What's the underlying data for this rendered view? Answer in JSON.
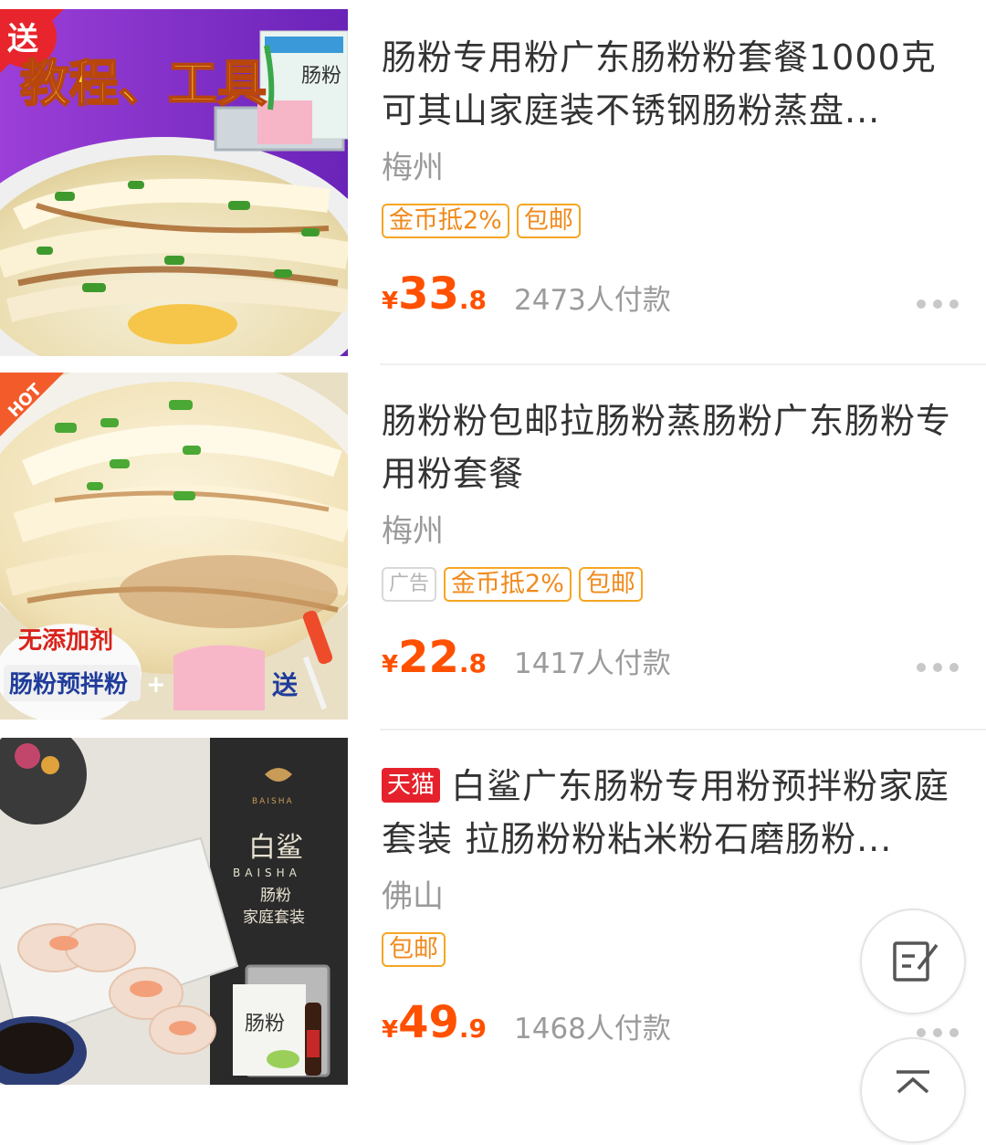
{
  "products": [
    {
      "badge": "送",
      "banner": "教程、工具",
      "pack_text": "肠粉",
      "title": "肠粉专用粉广东肠粉粉套餐1000克可其山家庭装不锈钢肠粉蒸盘...",
      "location": "梅州",
      "tags": [
        "金币抵2%",
        "包邮"
      ],
      "price_symbol": "¥",
      "price_int": "33",
      "price_dec": ".8",
      "paid": "2473人付款"
    },
    {
      "corner": "HOT",
      "promo_line1": "无添加剂",
      "promo_line2": "肠粉预拌粉",
      "plus": "+",
      "gift": "送",
      "title": "肠粉粉包邮拉肠粉蒸肠粉广东肠粉专用粉套餐",
      "location": "梅州",
      "ad_label": "广告",
      "tags": [
        "金币抵2%",
        "包邮"
      ],
      "price_symbol": "¥",
      "price_int": "22",
      "price_dec": ".8",
      "paid": "1417人付款"
    },
    {
      "tmall": "天猫",
      "brand_cn": "白鲨",
      "brand_en": "BAISHA",
      "brand_sub1": "肠粉",
      "brand_sub2": "家庭套装",
      "brand_logo_text": "BAISHA",
      "pack_text": "肠粉",
      "title": "白鲨广东肠粉专用粉预拌粉家庭套装 拉肠粉粉粘米粉石磨肠粉...",
      "location": "佛山",
      "tags": [
        "包邮"
      ],
      "price_symbol": "¥",
      "price_int": "49",
      "price_dec": ".9",
      "paid": "1468人付款"
    }
  ],
  "floating": {
    "feedback_icon": "edit-note-icon",
    "top_icon": "back-to-top-icon"
  }
}
